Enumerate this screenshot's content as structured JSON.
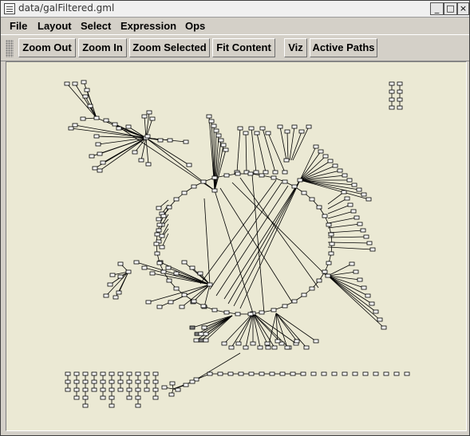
{
  "window": {
    "title": "data/galFiltered.gml",
    "controls": [
      "_",
      "□",
      "×"
    ]
  },
  "menu": [
    "File",
    "Layout",
    "Select",
    "Expression",
    "Ops"
  ],
  "toolbar": {
    "buttons": [
      "Zoom Out",
      "Zoom In",
      "Zoom Selected",
      "Fit Content",
      "Viz",
      "Active Paths"
    ]
  },
  "colors": {
    "canvas_bg": "#ebe9d4",
    "node_fill": "#ffffff",
    "node_selected_fill": "#808080",
    "edge": "#000000"
  }
}
